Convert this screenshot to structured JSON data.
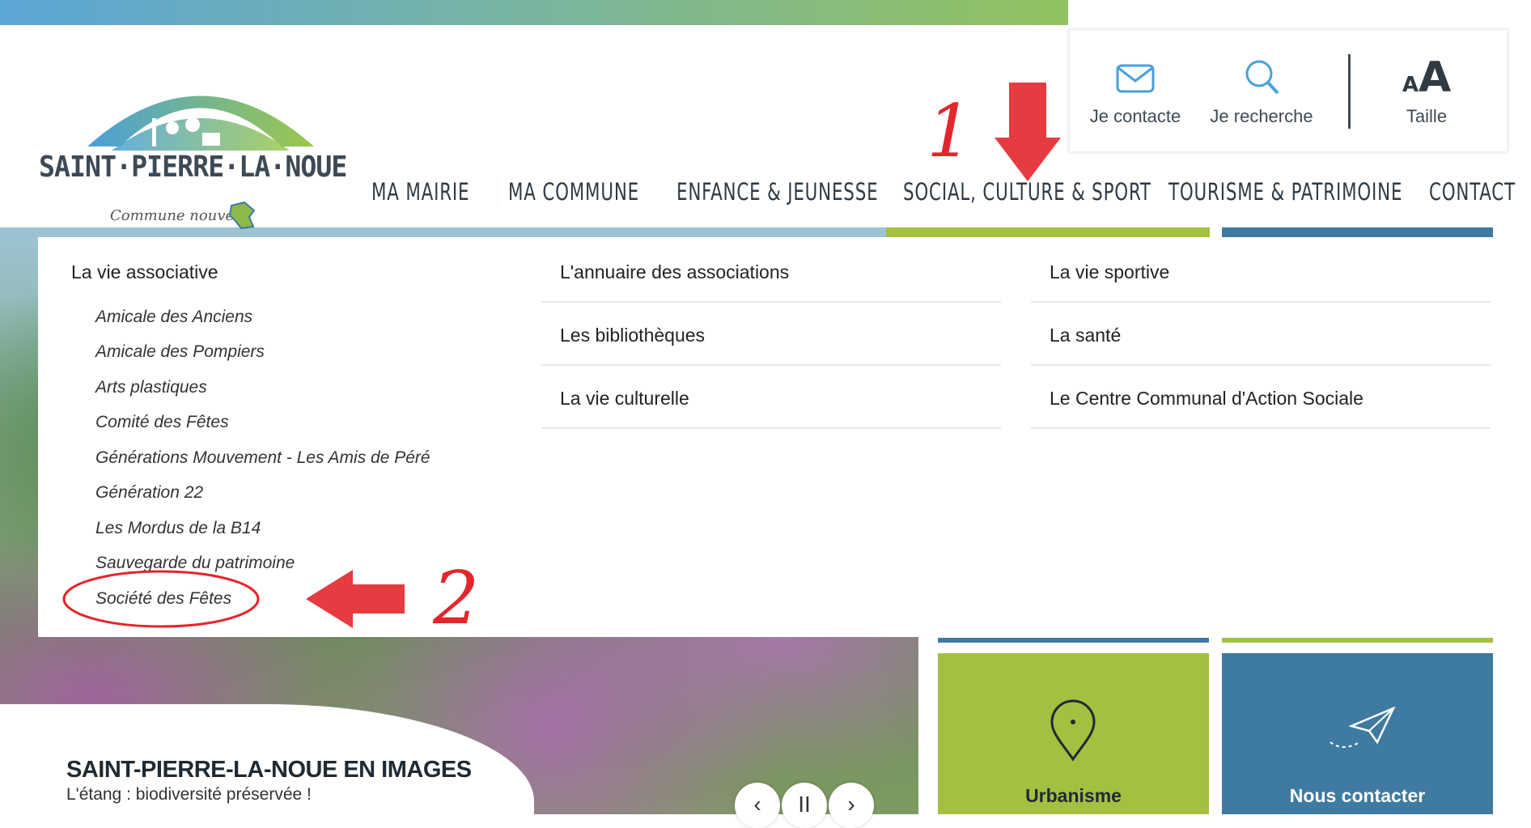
{
  "logo": {
    "name": "SAINT·PIERRE·LA·NOUE",
    "tagline": "Commune nouvelle"
  },
  "utility": {
    "contact_label": "Je contacte",
    "search_label": "Je recherche",
    "size_label": "Taille",
    "size_glyph_small": "A",
    "size_glyph_big": "A"
  },
  "nav": {
    "items": [
      "MA MAIRIE",
      "MA COMMUNE",
      "ENFANCE & JEUNESSE",
      "SOCIAL, CULTURE & SPORT",
      "TOURISME & PATRIMOINE",
      "CONTACT"
    ]
  },
  "dropdown": {
    "col1": {
      "heading": "La vie associative",
      "items": [
        "Amicale des Anciens",
        "Amicale des Pompiers",
        "Arts plastiques",
        "Comité des Fêtes",
        "Générations Mouvement - Les Amis de Péré",
        "Génération 22",
        "Les Mordus de la B14",
        "Sauvegarde du patrimoine",
        "Société des Fêtes"
      ]
    },
    "col2": {
      "items": [
        "L'annuaire des associations",
        "Les bibliothèques",
        "La vie culturelle"
      ]
    },
    "col3": {
      "items": [
        "La vie sportive",
        "La santé",
        "Le Centre Communal d'Action Sociale"
      ]
    }
  },
  "hero": {
    "title": "SAINT-PIERRE-LA-NOUE EN IMAGES",
    "subtitle": "L'étang : biodiversité préservée !",
    "prev": "‹",
    "pause": "II",
    "next": "›"
  },
  "tiles": {
    "urbanisme": "Urbanisme",
    "contact": "Nous contacter"
  },
  "annotations": {
    "step1": "1",
    "step2": "2"
  },
  "colors": {
    "green": "#a3c040",
    "blue": "#3f7aa0",
    "annotation_red": "#e3262b",
    "text_dark": "#2e3a44"
  }
}
